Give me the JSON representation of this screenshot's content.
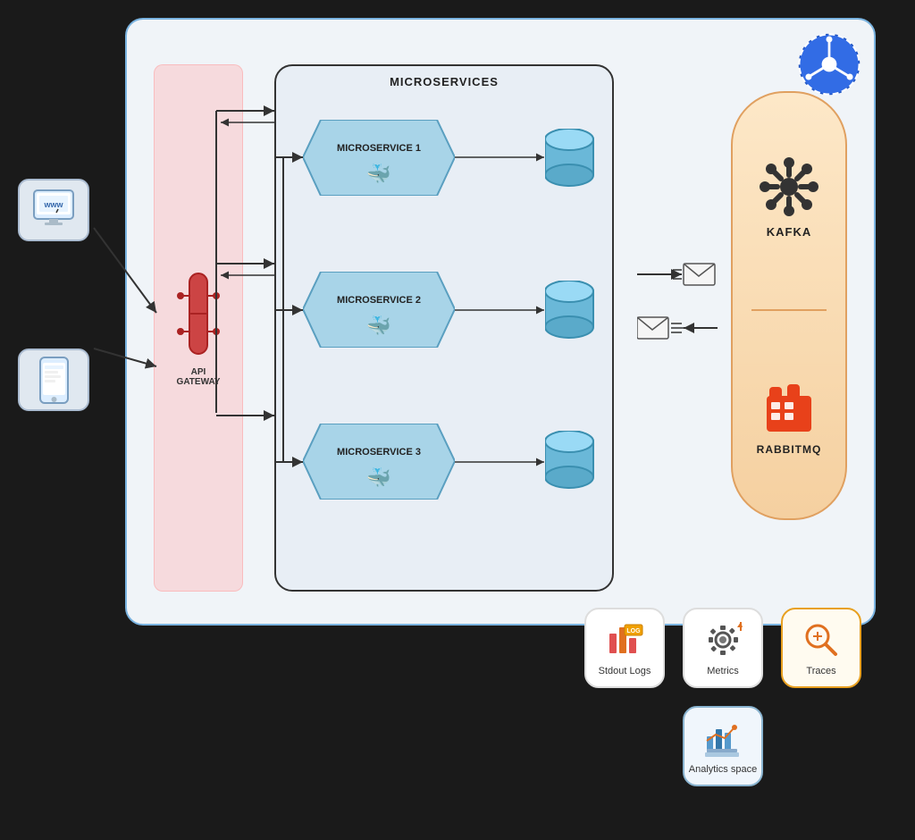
{
  "diagram": {
    "title": "MICROSERVICES",
    "kubernetes_label": "Kubernetes",
    "api_gateway": {
      "label": "API GATEWAY",
      "icon": "🔧"
    },
    "microservices": [
      {
        "id": 1,
        "label": "MICROSERVICE 1"
      },
      {
        "id": 2,
        "label": "MICROSERVICE 2"
      },
      {
        "id": 3,
        "label": "MICROSERVICE 3"
      }
    ],
    "messaging": {
      "kafka_label": "KAFKA",
      "rabbitmq_label": "RABBITMQ"
    },
    "clients": [
      {
        "id": "web",
        "icon": "🖥️"
      },
      {
        "id": "mobile",
        "icon": "📱"
      }
    ]
  },
  "observability": {
    "tools": [
      {
        "id": "stdout-logs",
        "label": "Stdout Logs",
        "icon": "📊"
      },
      {
        "id": "metrics",
        "label": "Metrics",
        "icon": "⚙️"
      },
      {
        "id": "traces",
        "label": "Traces",
        "icon": "🔍"
      }
    ],
    "analytics": {
      "label": "Analytics space",
      "icon": "📈"
    }
  }
}
